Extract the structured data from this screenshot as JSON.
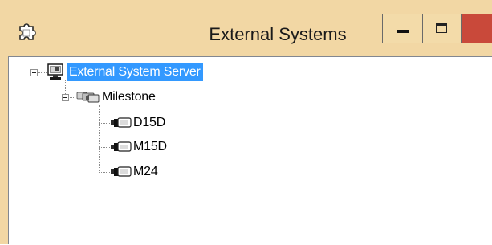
{
  "window": {
    "title": "External Systems",
    "icon": "puzzle-piece-icon",
    "accent": "#f2d7a4",
    "close_color": "#c9493a"
  },
  "tree": {
    "root": {
      "label": "External System Server",
      "icon": "server-monitor-icon",
      "selected": true,
      "expanded": true,
      "children": [
        {
          "label": "Milestone",
          "icon": "camera-group-icon",
          "expanded": true,
          "children": [
            {
              "label": "D15D",
              "icon": "camera-icon"
            },
            {
              "label": "M15D",
              "icon": "camera-icon"
            },
            {
              "label": "M24",
              "icon": "camera-icon"
            }
          ]
        }
      ]
    }
  },
  "colors": {
    "selection": "#3399ff"
  }
}
